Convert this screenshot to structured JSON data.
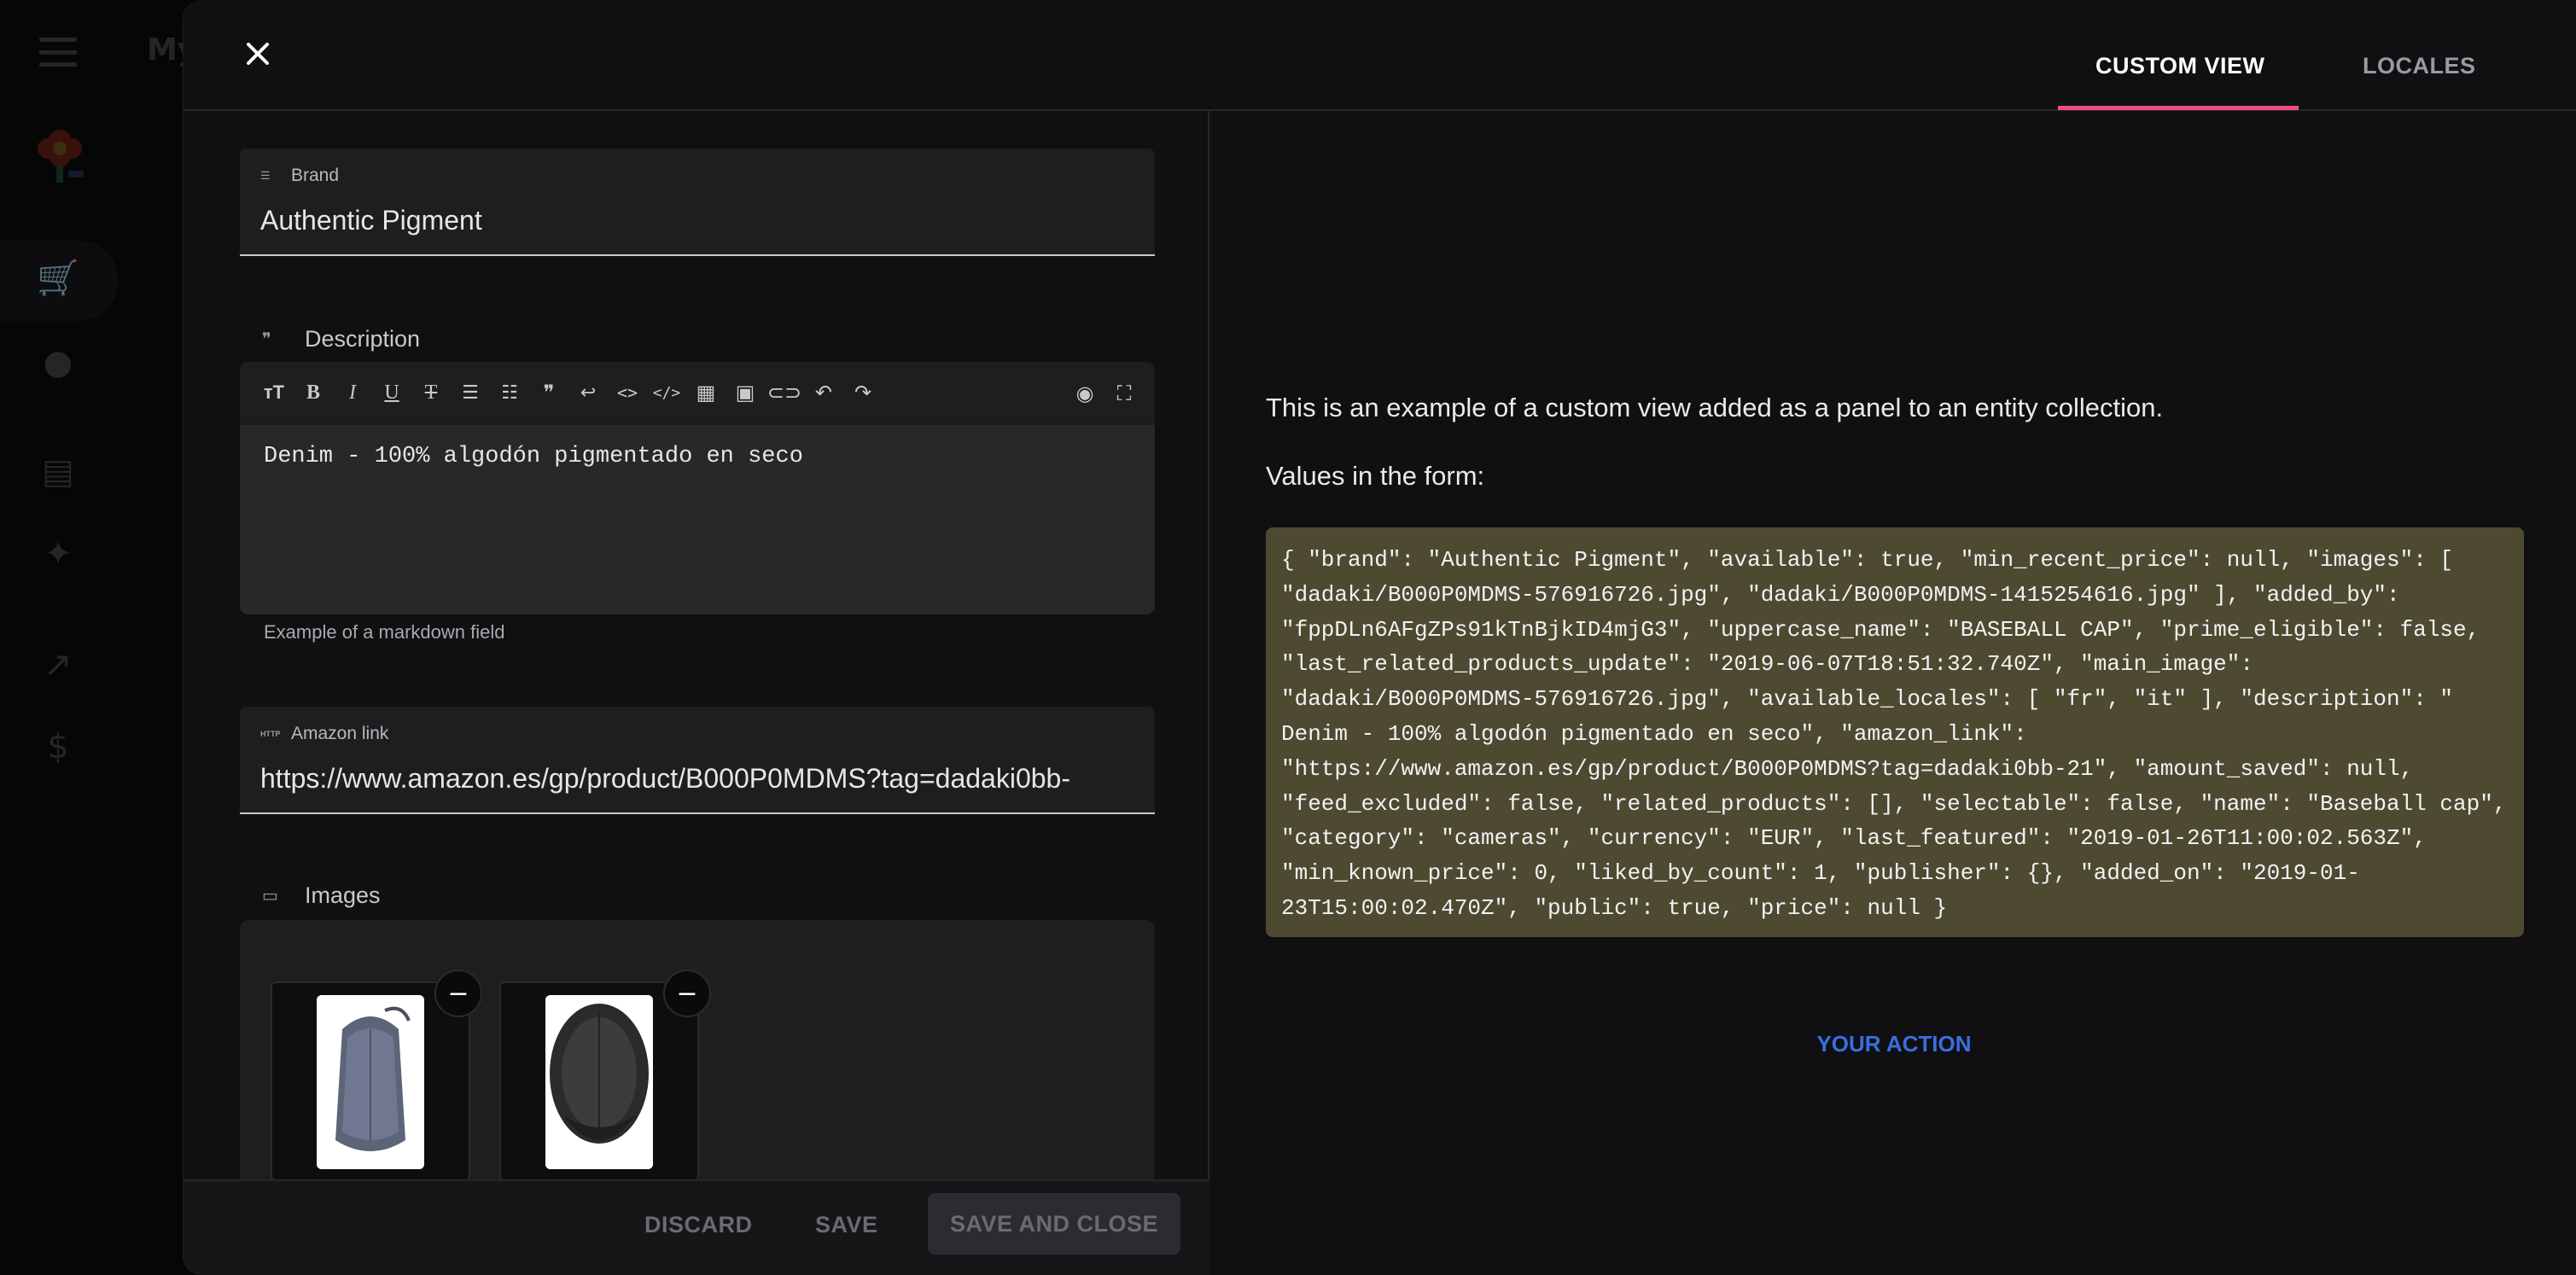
{
  "background_app": {
    "title": "My"
  },
  "drawer": {
    "close_icon": "close-icon",
    "tabs": [
      {
        "label": "CUSTOM VIEW",
        "active": true
      },
      {
        "label": "LOCALES",
        "active": false
      }
    ],
    "accent_color": "#ef4d7e"
  },
  "form": {
    "brand": {
      "label": "Brand",
      "value": "Authentic Pigment",
      "icon": "short-text-icon"
    },
    "description": {
      "label": "Description",
      "icon": "quote-icon",
      "value": "Denim - 100% algodón pigmentado en seco",
      "helper": "Example of a markdown field",
      "toolbar": [
        "text-size-icon",
        "bold-icon",
        "italic-icon",
        "underline-icon",
        "strikethrough-icon",
        "bullet-list-icon",
        "numbered-list-icon",
        "quote-icon",
        "wrap-icon",
        "inline-code-icon",
        "code-block-icon",
        "table-icon",
        "image-icon",
        "link-icon",
        "undo-icon",
        "redo-icon",
        "preview-icon",
        "fullscreen-icon"
      ]
    },
    "amazon_link": {
      "label": "Amazon link",
      "value": "https://www.amazon.es/gp/product/B000P0MDMS?tag=dadaki0bb-",
      "icon": "http-icon"
    },
    "images": {
      "label": "Images",
      "icon": "folder-icon",
      "count": 2
    }
  },
  "footer": {
    "discard": "DISCARD",
    "save": "SAVE",
    "save_and_close": "SAVE AND CLOSE"
  },
  "custom_view": {
    "intro": "This is an example of a custom view added as a panel to an entity collection.",
    "values_label": "Values in the form:",
    "json_text": "{ \"brand\": \"Authentic Pigment\", \"available\": true, \"min_recent_price\": null, \"images\": [ \"dadaki/B000P0MDMS-576916726.jpg\", \"dadaki/B000P0MDMS-1415254616.jpg\" ], \"added_by\": \"fppDLn6AFgZPs91kTnBjkID4mjG3\", \"uppercase_name\": \"BASEBALL CAP\", \"prime_eligible\": false, \"last_related_products_update\": \"2019-06-07T18:51:32.740Z\", \"main_image\": \"dadaki/B000P0MDMS-576916726.jpg\", \"available_locales\": [ \"fr\", \"it\" ], \"description\": \" Denim - 100% algodón pigmentado en seco\", \"amazon_link\": \"https://www.amazon.es/gp/product/B000P0MDMS?tag=dadaki0bb-21\", \"amount_saved\": null, \"feed_excluded\": false, \"related_products\": [], \"selectable\": false, \"name\": \"Baseball cap\", \"category\": \"cameras\", \"currency\": \"EUR\", \"last_featured\": \"2019-01-26T11:00:02.563Z\", \"min_known_price\": 0, \"liked_by_count\": 1, \"publisher\": {}, \"added_on\": \"2019-01-23T15:00:02.470Z\", \"public\": true, \"price\": null }",
    "action_label": "YOUR ACTION",
    "code_bg": "#4e4a32",
    "action_color": "#3a6ee0"
  }
}
